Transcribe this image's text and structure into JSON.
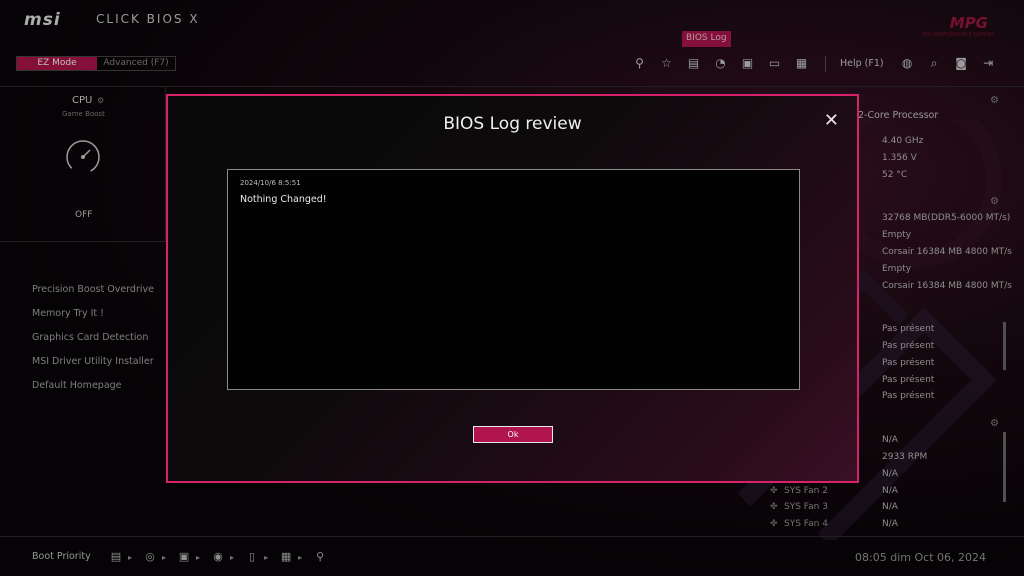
{
  "header": {
    "brand": "msi",
    "product": "CLICK BIOS X",
    "logo": "MPG",
    "logo_sub": "MSI PERFORMANCE GAMING",
    "bios_log_tab": "BIOS Log"
  },
  "modes": {
    "ez": "EZ Mode",
    "advanced": "Advanced (F7)"
  },
  "toolbar": {
    "icons": [
      "usb-icon",
      "star-icon",
      "document-icon",
      "gauge-icon",
      "memory-icon",
      "image-icon",
      "chip-icon"
    ],
    "help": "Help (F1)",
    "right_icons": [
      "globe-icon",
      "search-icon",
      "camera-icon",
      "exit-icon"
    ]
  },
  "cpu": {
    "title": "CPU",
    "subtitle": "Game Boost",
    "state": "OFF"
  },
  "menu": {
    "items": [
      "Precision Boost Overdrive",
      "Memory Try It !",
      "Graphics Card Detection",
      "MSI Driver Utility Installer",
      "Default Homepage"
    ]
  },
  "info": {
    "processor": "2-Core Processor",
    "cpu_vals": [
      "4.40 GHz",
      "1.356 V",
      "52 °C"
    ],
    "mem_vals": [
      "32768 MB(DDR5-6000 MT/s)",
      "Empty",
      "Corsair 16384 MB 4800 MT/s",
      "Empty",
      "Corsair 16384 MB 4800 MT/s"
    ],
    "storage_vals": [
      "Pas présent",
      "Pas présent",
      "Pas présent",
      "Pas présent",
      "Pas présent"
    ],
    "fan_vals": [
      "N/A",
      "2933 RPM",
      "N/A",
      "N/A",
      "N/A",
      "N/A"
    ],
    "fan_labels": [
      "SYS Fan 2",
      "SYS Fan 3",
      "SYS Fan 4"
    ]
  },
  "bottom": {
    "boot_priority": "Boot Priority",
    "clock": "08:05  dim Oct 06, 2024"
  },
  "modal": {
    "title": "BIOS Log review",
    "close": "✕",
    "log_time": "2024/10/6 8:5:51",
    "log_message": "Nothing Changed!",
    "ok": "Ok"
  },
  "colors": {
    "accent": "#b0154d",
    "accent_border": "#d6226a"
  }
}
